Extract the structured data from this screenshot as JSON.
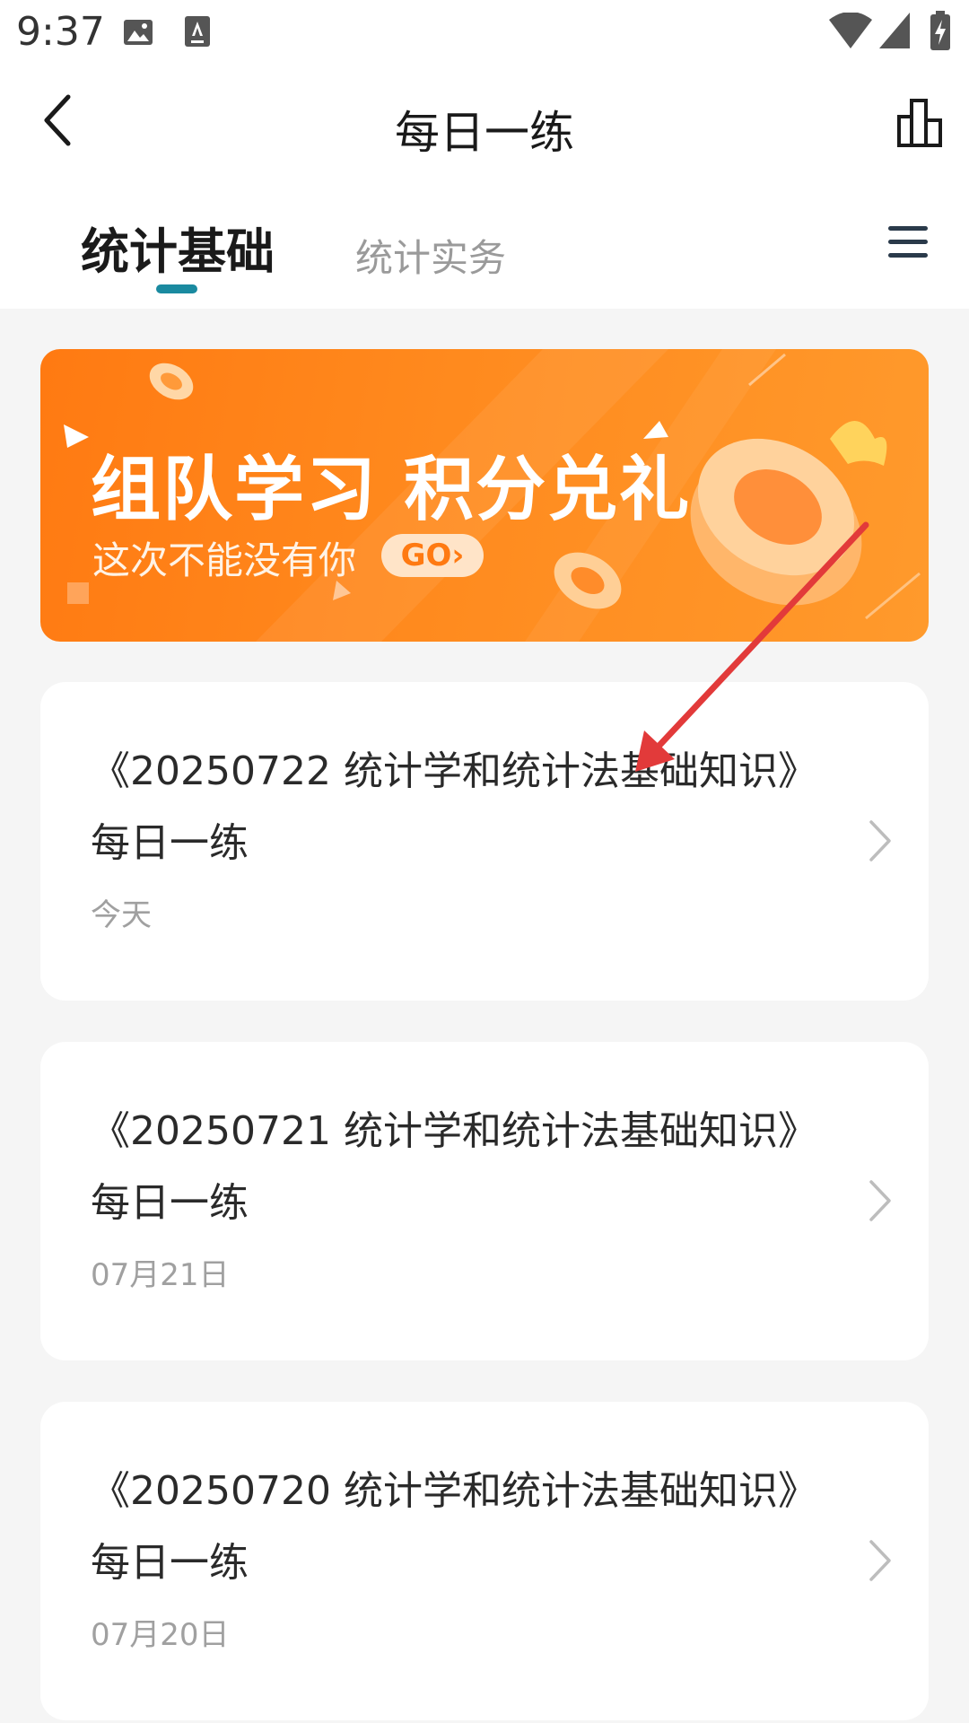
{
  "status_bar": {
    "time": "9:37",
    "icons": [
      "image-icon",
      "font-icon",
      "wifi-icon",
      "signal-icon",
      "battery-charging-icon"
    ]
  },
  "nav": {
    "title": "每日一练",
    "back_icon": "chevron-left-icon",
    "stats_icon": "bar-chart-icon"
  },
  "tabs": [
    {
      "label": "统计基础",
      "active": true
    },
    {
      "label": "统计实务",
      "active": false
    }
  ],
  "tab_menu_icon": "hamburger-menu-icon",
  "colors": {
    "accent": "#1a8aa0",
    "banner": "#ff8a1e",
    "annotation_arrow": "#e23a3a"
  },
  "banner": {
    "title": "组队学习 积分兑礼",
    "subtitle": "这次不能没有你",
    "go_label": "GO›"
  },
  "cards": [
    {
      "title": "《20250722 统计学和统计法基础知识》每日一练",
      "date": "今天"
    },
    {
      "title": "《20250721 统计学和统计法基础知识》每日一练",
      "date": "07月21日"
    },
    {
      "title": "《20250720 统计学和统计法基础知识》每日一练",
      "date": "07月20日"
    }
  ]
}
